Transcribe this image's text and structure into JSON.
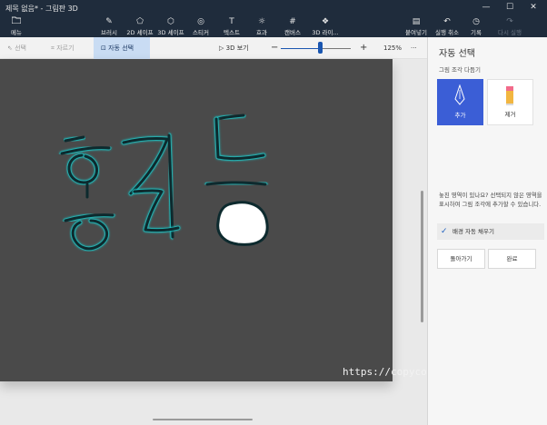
{
  "window": {
    "title": "제목 없음* - 그림판 3D",
    "controls": [
      "—",
      "☐",
      "✕"
    ]
  },
  "toolbar": {
    "menu": {
      "label": "메뉴",
      "icon": "folder-icon"
    },
    "tools": [
      {
        "label": "브러시",
        "icon": "brush-icon"
      },
      {
        "label": "2D 셰이프",
        "icon": "shapes-2d-icon"
      },
      {
        "label": "3D 셰이프",
        "icon": "cube-icon"
      },
      {
        "label": "스티커",
        "icon": "sticker-icon"
      },
      {
        "label": "텍스트",
        "icon": "text-icon"
      },
      {
        "label": "효과",
        "icon": "effects-sun-icon"
      },
      {
        "label": "캔버스",
        "icon": "canvas-grid-icon"
      },
      {
        "label": "3D 라이...",
        "icon": "library-icon"
      }
    ],
    "actions": [
      {
        "label": "붙여넣기",
        "icon": "paste-icon"
      },
      {
        "label": "실행 취소",
        "icon": "undo-icon"
      },
      {
        "label": "기록",
        "icon": "history-icon"
      },
      {
        "label": "다시 실행",
        "icon": "redo-icon",
        "disabled": true
      }
    ]
  },
  "subbar": {
    "select": "선택",
    "crop": "자르기",
    "magic_select": "자동 선택",
    "view_3d": "3D 보기",
    "zoom_minus": "−",
    "zoom_plus": "+",
    "zoom_level": "125%",
    "zoom_fraction": 0.56,
    "more": "···"
  },
  "canvas": {
    "background": "#4a4a4a",
    "stroke_color": "#0d2a2e",
    "glow_color": "#1fc6c6",
    "watermark": "https://copycoding.tistory.com/"
  },
  "panel": {
    "title": "자동 선택",
    "subtitle": "그림 조각 다듬기",
    "add_label": "추가",
    "remove_label": "제거",
    "description": "놓친 영역이 있나요? 선택되지 않은 영역을 표시하여 그림 조각에 추가할 수 있습니다.",
    "autofill_label": "배경 자동 채우기",
    "back_label": "돌아가기",
    "done_label": "완료"
  },
  "colors": {
    "titlebar": "#1f2c3c",
    "accent": "#3b5ed6",
    "active_tab": "#c9dcf3"
  }
}
